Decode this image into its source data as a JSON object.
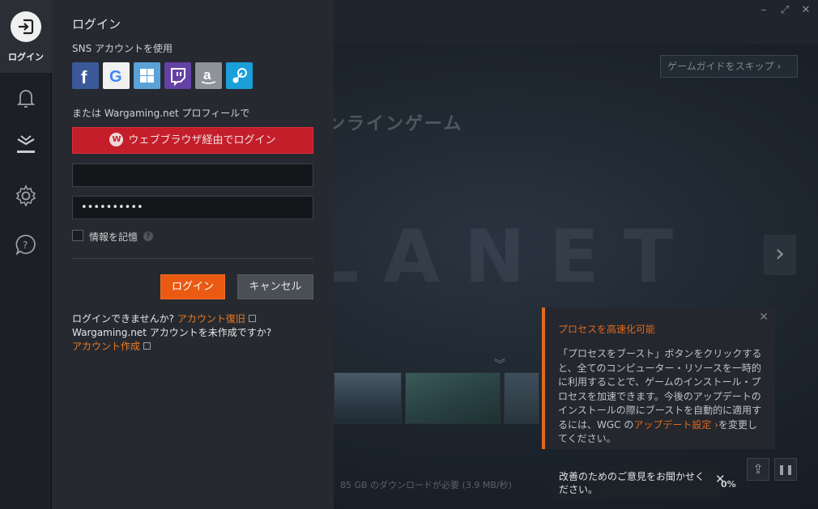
{
  "background": {
    "skip_guide": "ゲームガイドをスキップ ›",
    "hero_title": "オンラインゲーム",
    "watermark": "PLANET",
    "download_status": "85 GB のダウンロードが必要 (3.9 MB/秒)",
    "download_percent": "0%"
  },
  "sidebar": {
    "login_label": "ログイン",
    "icons": [
      "login-icon",
      "bell-icon",
      "download-icon",
      "gear-icon",
      "help-chat-icon"
    ]
  },
  "login_panel": {
    "title": "ログイン",
    "sns_label": "SNS アカウントを使用",
    "sns_buttons": [
      "facebook",
      "google",
      "windows",
      "twitch",
      "amazon",
      "steam"
    ],
    "or_label": "または Wargaming.net プロフィールで",
    "browser_login": "ウェブブラウザ経由でログイン",
    "email_value": "",
    "password_value": "••••••••••",
    "remember_label": "情報を記憶",
    "login_button": "ログイン",
    "cancel_button": "キャンセル",
    "cant_login": "ログインできませんか?",
    "recover_link": "アカウント復旧",
    "no_account": "Wargaming.net アカウントを未作成ですか?",
    "create_link": "アカウント作成"
  },
  "boost_tip": {
    "title": "プロセスを高速化可能",
    "body": "「プロセスをブースト」ボタンをクリックすると、全てのコンピューター・リソースを一時的に利用することで、ゲームのインストール・プロセスを加速できます。今後のアップデートのインストールの際にブーストを自動的に適用するには、WGC の",
    "link": "アップデート設定 ›",
    "tail": "を変更してください。"
  },
  "feedback": {
    "text": "改善のためのご意見をお聞かせください。"
  },
  "colors": {
    "accent_orange": "#ea5a12",
    "browser_red": "#c41e2a",
    "panel_bg": "#262a30"
  }
}
